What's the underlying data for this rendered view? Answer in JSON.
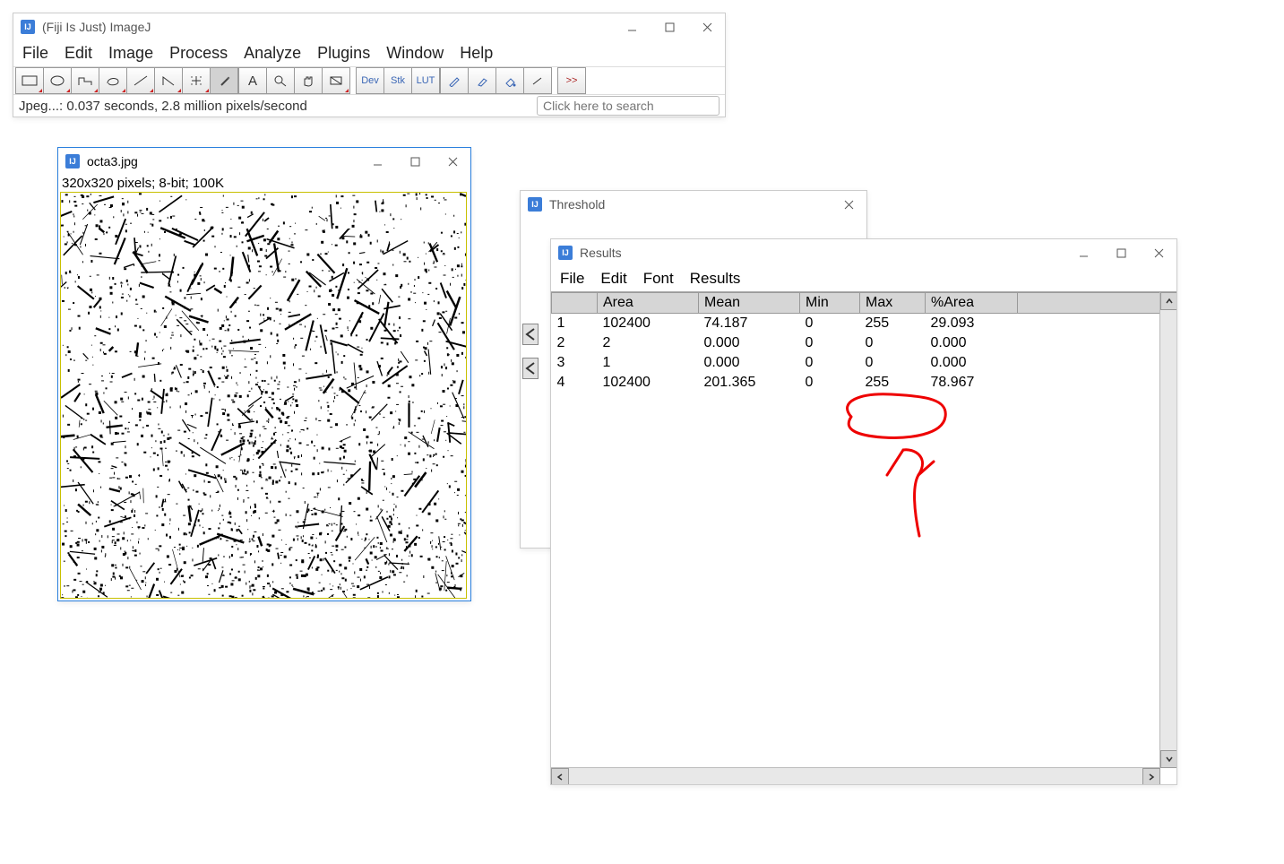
{
  "main_window": {
    "title": "(Fiji Is Just) ImageJ",
    "menus": [
      "File",
      "Edit",
      "Image",
      "Process",
      "Analyze",
      "Plugins",
      "Window",
      "Help"
    ],
    "tool_labels": {
      "dev": "Dev",
      "stk": "Stk",
      "lut": "LUT",
      "more": ">>"
    },
    "status_text": "Jpeg...: 0.037 seconds, 2.8 million pixels/second",
    "search_placeholder": "Click here to search"
  },
  "image_window": {
    "title": "octa3.jpg",
    "info_line": "320x320 pixels; 8-bit; 100K"
  },
  "threshold_window": {
    "title": "Threshold"
  },
  "results_window": {
    "title": "Results",
    "menus": [
      "File",
      "Edit",
      "Font",
      "Results"
    ],
    "columns": [
      "",
      "Area",
      "Mean",
      "Min",
      "Max",
      "%Area"
    ],
    "rows": [
      {
        "n": "1",
        "Area": "102400",
        "Mean": "74.187",
        "Min": "0",
        "Max": "255",
        "PctArea": "29.093"
      },
      {
        "n": "2",
        "Area": "2",
        "Mean": "0.000",
        "Min": "0",
        "Max": "0",
        "PctArea": "0.000"
      },
      {
        "n": "3",
        "Area": "1",
        "Mean": "0.000",
        "Min": "0",
        "Max": "0",
        "PctArea": "0.000"
      },
      {
        "n": "4",
        "Area": "102400",
        "Mean": "201.365",
        "Min": "0",
        "Max": "255",
        "PctArea": "78.967"
      }
    ]
  }
}
